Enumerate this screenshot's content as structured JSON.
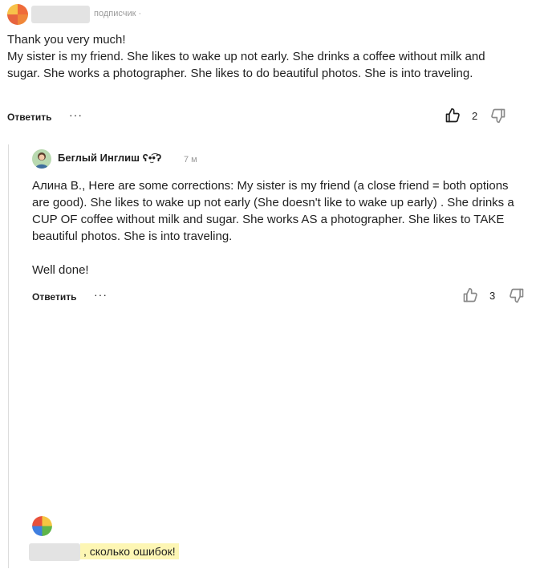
{
  "comment1": {
    "role": "подписчик",
    "separator": "·",
    "text": "Thank you very much!\nMy sister is my friend. She likes to wake up not early. She drinks a coffee without milk and sugar. She works a photographer. She likes to do beautiful photos. She is into traveling.",
    "reply_label": "Ответить",
    "more_label": "···",
    "likes": "2"
  },
  "comment2": {
    "author": "Беглый Инглиш ʕ•̫͡•ʔ",
    "time": "7 м",
    "text": "Алина В., Here are some corrections: My sister is my friend (a close friend = both options are good). She likes to wake up not  early (She doesn't like to wake up early) . She drinks a CUP OF coffee without milk and sugar. She works AS a photographer. She likes to TAKE  beautiful photos. She is into traveling.\n\nWell done!",
    "reply_label": "Ответить",
    "more_label": "···",
    "likes": "3"
  },
  "compose": {
    "text": ", сколько ошибок!"
  },
  "icons": {
    "like": "thumbs-up-icon",
    "dislike": "thumbs-down-icon",
    "avatar_logo": "platform-logo-icon"
  }
}
